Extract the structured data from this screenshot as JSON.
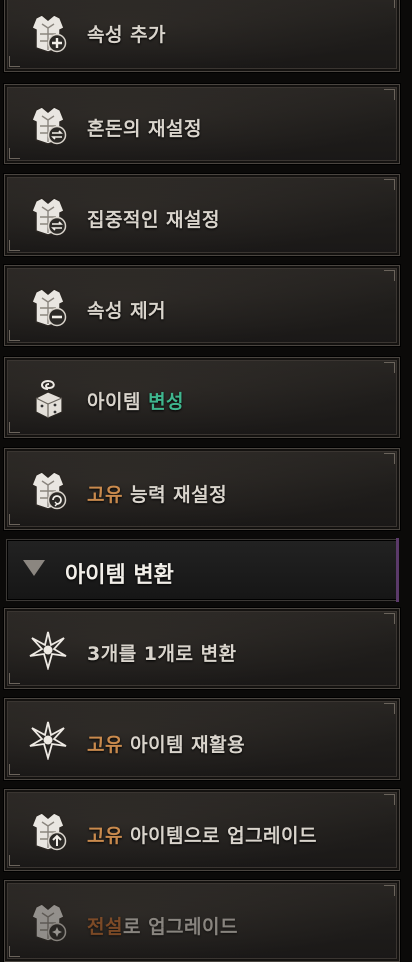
{
  "menu": {
    "items": [
      {
        "id": "add_affix",
        "icon": "armor-plus-icon",
        "parts": [
          {
            "text": "속성 추가"
          }
        ]
      },
      {
        "id": "chaos_reroll",
        "icon": "armor-swap-icon",
        "parts": [
          {
            "text": "혼돈의 재설정"
          }
        ]
      },
      {
        "id": "focused_reroll",
        "icon": "armor-swap-icon",
        "parts": [
          {
            "text": "집중적인 재설정"
          }
        ]
      },
      {
        "id": "remove_affix",
        "icon": "armor-minus-icon",
        "parts": [
          {
            "text": "속성 제거"
          }
        ]
      },
      {
        "id": "item_transmute",
        "icon": "spiral-cube-icon",
        "parts": [
          {
            "text": "아이템 "
          },
          {
            "text": "변성",
            "highlight": "hl-green"
          }
        ]
      },
      {
        "id": "unique_reroll",
        "icon": "armor-refresh-icon",
        "parts": [
          {
            "text": "고유",
            "highlight": "hl-unique"
          },
          {
            "text": " 능력 재설정"
          }
        ]
      }
    ]
  },
  "section": {
    "title": "아이템 변환"
  },
  "conversion": {
    "items": [
      {
        "id": "three_to_one",
        "icon": "star-burst-icon",
        "parts": [
          {
            "text": "3개를 1개로 변환"
          }
        ]
      },
      {
        "id": "unique_recycle",
        "icon": "star-burst-icon",
        "parts": [
          {
            "text": "고유",
            "highlight": "hl-unique"
          },
          {
            "text": " 아이템 재활용"
          }
        ]
      },
      {
        "id": "upgrade_unique",
        "icon": "armor-up-icon",
        "parts": [
          {
            "text": "고유",
            "highlight": "hl-unique"
          },
          {
            "text": " 아이템으로 업그레이드"
          }
        ]
      },
      {
        "id": "upgrade_legendary",
        "icon": "armor-legend-icon",
        "dim": true,
        "parts": [
          {
            "text": "전설",
            "highlight": "hl-legend"
          },
          {
            "text": "로 업그레이드"
          }
        ]
      }
    ]
  }
}
